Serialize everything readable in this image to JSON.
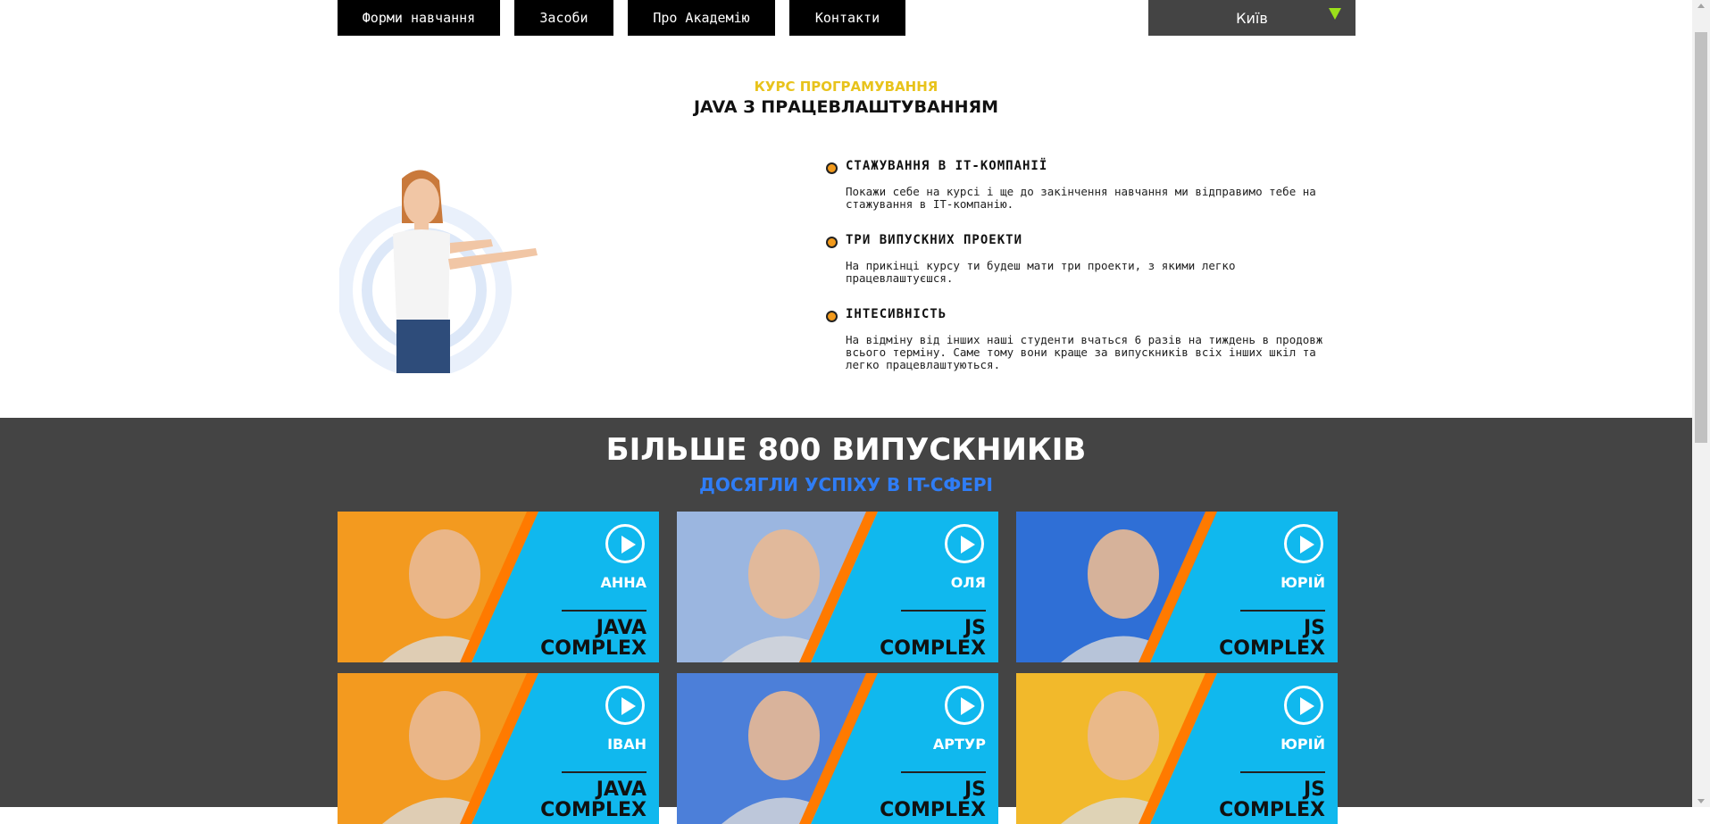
{
  "nav": {
    "items": [
      {
        "label": "Форми навчання"
      },
      {
        "label": "Засоби"
      },
      {
        "label": "Про Академію"
      },
      {
        "label": "Контакти"
      }
    ],
    "city": "Київ"
  },
  "course": {
    "kicker": "КУРС ПРОГРАМУВАННЯ",
    "title": "JAVA З ПРАЦЕВЛАШТУВАННЯМ"
  },
  "features": [
    {
      "title": "СТАЖУВАННЯ В IT-КОМПАНІЇ",
      "text": "Покажи себе на курсі і ще до закінчення навчання ми відправимо тебе на стажування в IT-компанію."
    },
    {
      "title": "ТРИ ВИПУСКНИХ ПРОЕКТИ",
      "text": "На прикінці курсу ти будеш мати три проекти, з якими легко працевлаштуєшся."
    },
    {
      "title": "ІНТЕСИВНІСТЬ",
      "text": "На відміну від інших наші студенти вчаться 6 разів на тиждень в продовж всього терміну. Саме тому вони краще за випускників всіх інших шкіл та легко працевлаштуються."
    }
  ],
  "graduates": {
    "title": "БІЛЬШЕ 800 ВИПУСКНИКІВ",
    "subtitle": "ДОСЯГЛИ УСПІХУ В IT-СФЕРІ",
    "cards": [
      {
        "name": "АННА",
        "course_line1": "JAVA",
        "course_line2": "COMPLEX",
        "left_color": "#f39a1f"
      },
      {
        "name": "ОЛЯ",
        "course_line1": "JS",
        "course_line2": "COMPLEX",
        "left_color": "#9bb6e0"
      },
      {
        "name": "ЮРІЙ",
        "course_line1": "JS",
        "course_line2": "COMPLEX",
        "left_color": "#2f6fd6"
      },
      {
        "name": "ІВАН",
        "course_line1": "JAVA",
        "course_line2": "COMPLEX",
        "left_color": "#f39a1f"
      },
      {
        "name": "АРТУР",
        "course_line1": "JS",
        "course_line2": "COMPLEX",
        "left_color": "#4c7fd9"
      },
      {
        "name": "ЮРІЙ",
        "course_line1": "JS",
        "course_line2": "COMPLEX",
        "left_color": "#f2b92b"
      }
    ]
  },
  "colors": {
    "accent_yellow": "#e8c31c",
    "accent_blue": "#2f7df6",
    "dark_bg": "#444444",
    "card_cyan": "#10b8ee",
    "stripe_orange": "#ff7a00"
  },
  "icons": {
    "dropdown": "triangle-down-icon",
    "play": "play-circle-icon",
    "bullet": "orange-dot-icon"
  }
}
